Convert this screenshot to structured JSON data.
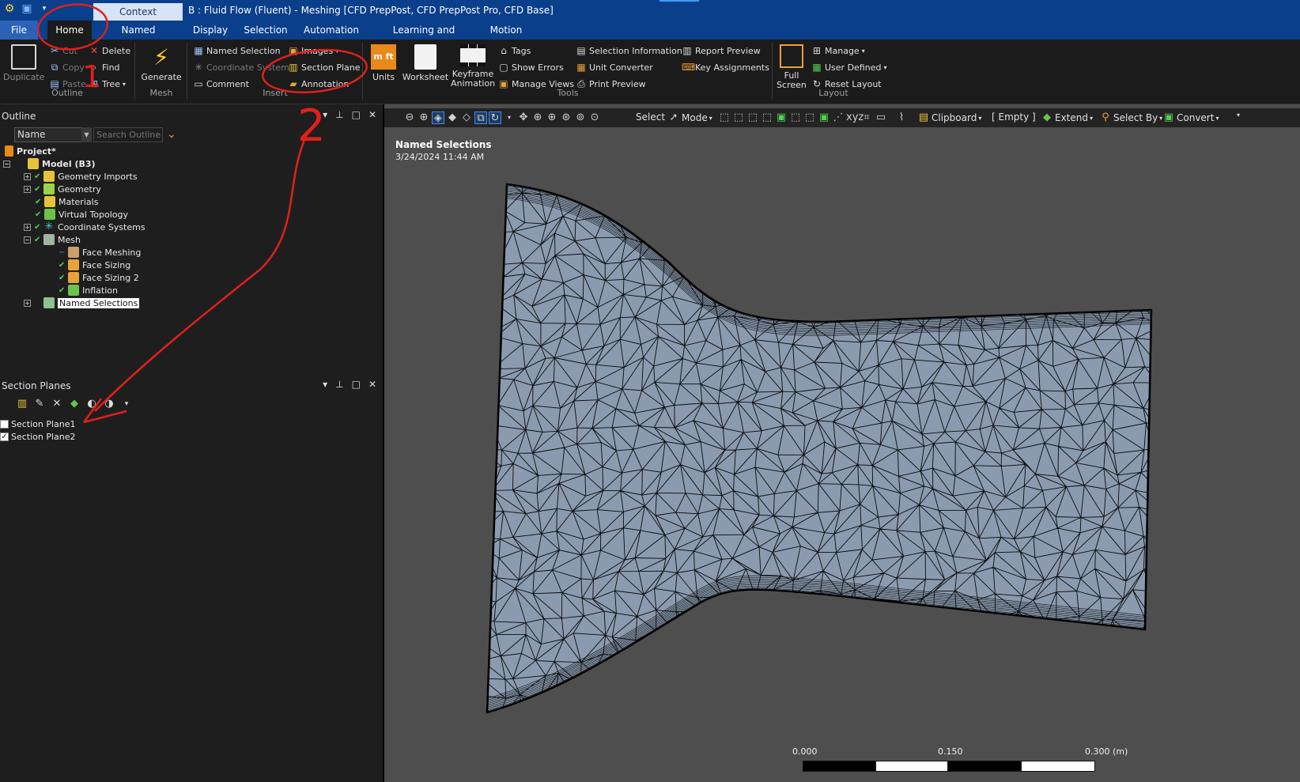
{
  "window": {
    "context_tab": "Context",
    "title": "B : Fluid Flow (Fluent) - Meshing [CFD PrepPost, CFD PrepPost Pro, CFD Base]"
  },
  "menu": {
    "tabs": [
      "File",
      "Home",
      "Named Selection",
      "Display",
      "Selection",
      "Automation",
      "Learning and Support",
      "Motion"
    ]
  },
  "ribbon": {
    "outline_group": {
      "duplicate": "Duplicate",
      "cut": "Cut",
      "copy": "Copy",
      "paste": "Paste",
      "delete": "Delete",
      "find": "Find",
      "tree": "Tree",
      "label": "Outline"
    },
    "mesh_group": {
      "generate": "Generate",
      "label": "Mesh"
    },
    "insert_group": {
      "named_selection": "Named Selection",
      "coordinate_system": "Coordinate System",
      "comment": "Comment",
      "images": "Images",
      "section_plane": "Section Plane",
      "annotation": "Annotation",
      "label": "Insert"
    },
    "tools_group": {
      "units": "Units",
      "worksheet": "Worksheet",
      "keyframe_animation_1": "Keyframe",
      "keyframe_animation_2": "Animation",
      "tags": "Tags",
      "show_errors": "Show Errors",
      "manage_views": "Manage Views",
      "selection_information": "Selection Information",
      "unit_converter": "Unit Converter",
      "print_preview": "Print Preview",
      "report_preview": "Report Preview",
      "key_assignments": "Key Assignments",
      "label": "Tools"
    },
    "layout_group": {
      "full_screen_1": "Full",
      "full_screen_2": "Screen",
      "manage": "Manage",
      "user_defined": "User Defined",
      "reset_layout": "Reset Layout",
      "label": "Layout"
    }
  },
  "outline": {
    "title": "Outline",
    "name_column": "Name",
    "search_placeholder": "Search Outline",
    "tree": [
      {
        "label": "Project*",
        "state": ""
      },
      {
        "label": "Model (B3)",
        "state": ""
      },
      {
        "label": "Geometry Imports",
        "state": "ok"
      },
      {
        "label": "Geometry",
        "state": "ok"
      },
      {
        "label": "Materials",
        "state": "ok"
      },
      {
        "label": "Virtual Topology",
        "state": "ok"
      },
      {
        "label": "Coordinate Systems",
        "state": "ok"
      },
      {
        "label": "Mesh",
        "state": "ok"
      },
      {
        "label": "Face Meshing",
        "state": "suppressed"
      },
      {
        "label": "Face Sizing",
        "state": "ok"
      },
      {
        "label": "Face Sizing 2",
        "state": "ok"
      },
      {
        "label": "Inflation",
        "state": "ok"
      },
      {
        "label": "Named Selections",
        "state": "selected"
      }
    ]
  },
  "section_planes": {
    "title": "Section Planes",
    "items": [
      {
        "label": "Section Plane1",
        "checked": false
      },
      {
        "label": "Section Plane2",
        "checked": true
      }
    ]
  },
  "viewport": {
    "toolbar": {
      "select": "Select",
      "mode": "Mode",
      "clipboard": "Clipboard",
      "empty": "[ Empty ]",
      "extend": "Extend",
      "select_by": "Select By",
      "convert": "Convert"
    },
    "label_title": "Named Selections",
    "label_date": "3/24/2024 11:44 AM",
    "scale": {
      "labels": [
        "0.000",
        "0.150",
        "0.300 (m)"
      ]
    }
  },
  "annotations": {
    "step1": "1",
    "step2": "2"
  },
  "colors": {
    "title_bar": "#0a3f8c",
    "ribbon_bg": "#1b1b1b",
    "panel_bg": "#1e1e1e",
    "viewport_bg": "#4e4e4e",
    "mesh_fill": "#8a9bb0",
    "annotation_red": "#e0201a",
    "ok_check": "#4fd14f"
  }
}
